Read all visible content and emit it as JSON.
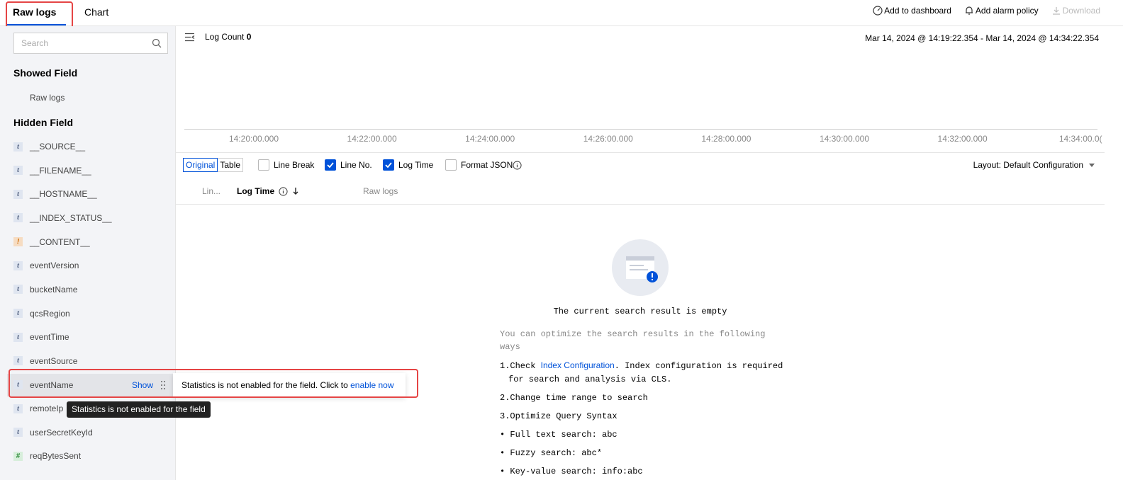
{
  "tabs": {
    "raw_logs": "Raw logs",
    "chart": "Chart"
  },
  "actions": {
    "add_dashboard": "Add to dashboard",
    "add_alarm": "Add alarm policy",
    "download": "Download"
  },
  "sidebar": {
    "search_placeholder": "Search",
    "showed_field_title": "Showed Field",
    "showed_fields": [
      "Raw logs"
    ],
    "hidden_field_title": "Hidden Field",
    "hidden_fields": [
      {
        "name": "__SOURCE__",
        "type": "t"
      },
      {
        "name": "__FILENAME__",
        "type": "t"
      },
      {
        "name": "__HOSTNAME__",
        "type": "t"
      },
      {
        "name": "__INDEX_STATUS__",
        "type": "t"
      },
      {
        "name": "__CONTENT__",
        "type": "!"
      },
      {
        "name": "eventVersion",
        "type": "t"
      },
      {
        "name": "bucketName",
        "type": "t"
      },
      {
        "name": "qcsRegion",
        "type": "t"
      },
      {
        "name": "eventTime",
        "type": "t"
      },
      {
        "name": "eventSource",
        "type": "t"
      },
      {
        "name": "eventName",
        "type": "t"
      },
      {
        "name": "remoteIp",
        "type": "t"
      },
      {
        "name": "userSecretKeyId",
        "type": "t"
      },
      {
        "name": "reqBytesSent",
        "type": "#"
      }
    ],
    "show_label": "Show",
    "tooltip": "Statistics is not enabled for the field"
  },
  "popover": {
    "text": "Statistics is not enabled for the field. Click to ",
    "link": "enable now"
  },
  "main": {
    "log_count_label": "Log Count",
    "log_count_value": "0",
    "time_range": "Mar 14, 2024 @ 14:19:22.354 - Mar 14, 2024 @ 14:34:22.354",
    "ticks": [
      "14:20:00.000",
      "14:22:00.000",
      "14:24:00.000",
      "14:26:00.000",
      "14:28:00.000",
      "14:30:00.000",
      "14:32:00.000",
      "14:34:00.0("
    ],
    "view_original": "Original",
    "view_table": "Table",
    "opt_line_break": "Line Break",
    "opt_line_no": "Line No.",
    "opt_log_time": "Log Time",
    "opt_format_json": "Format JSON",
    "layout": "Layout: Default Configuration",
    "col_line": "Lin...",
    "col_log_time": "Log Time",
    "col_raw_logs": "Raw logs"
  },
  "empty": {
    "title": "The current search result is empty",
    "subtitle": "You can optimize the search results in the following ways",
    "step1_pre": "1.Check ",
    "step1_link": "Index Configuration",
    "step1_post": ". Index configuration is required",
    "step1_cont": "for search and analysis via CLS.",
    "step2": "2.Change time range to search",
    "step3": "3.Optimize Query Syntax",
    "bullet1": "Full text search: abc",
    "bullet2": "Fuzzy search: abc*",
    "bullet3": "Key-value search: info:abc"
  },
  "colors": {
    "accent": "#0052d9",
    "highlight": "#e54545"
  }
}
